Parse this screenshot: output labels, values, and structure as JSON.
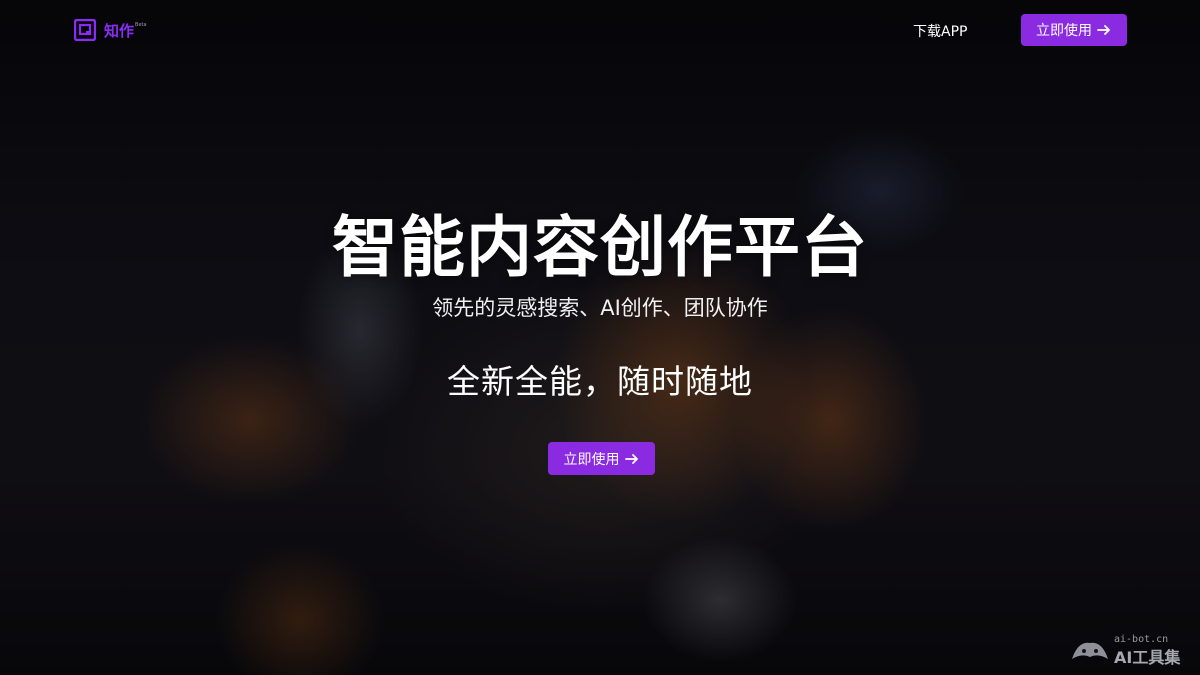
{
  "nav": {
    "logo_text": "知作",
    "logo_badge": "Beta",
    "download_label": "下载APP",
    "cta_label": "立即使用"
  },
  "hero": {
    "title": "智能内容创作平台",
    "subtitle": "领先的灵感搜索、AI创作、团队协作",
    "tagline": "全新全能，随时随地",
    "cta_label": "立即使用"
  },
  "watermark": {
    "domain": "ai-bot.cn",
    "name": "AI工具集"
  },
  "colors": {
    "accent": "#8a2be2",
    "logo": "#8b2cf5",
    "background": "#0b0b0f"
  },
  "icons": [
    "logo-icon",
    "arrow-right-icon",
    "watermark-bot-icon"
  ]
}
